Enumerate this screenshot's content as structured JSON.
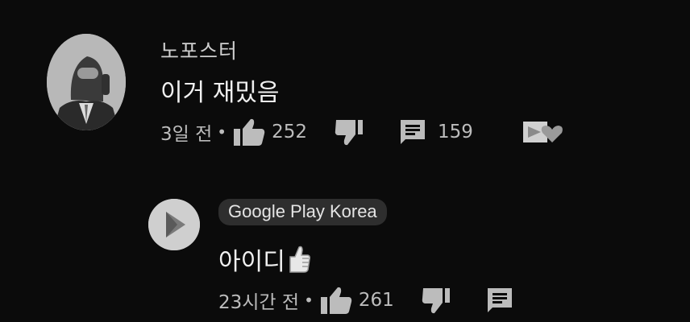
{
  "comment": {
    "author": "노포스터",
    "text": "이거 재밌음",
    "age": "3일 전",
    "dot": "•",
    "like_count": "252",
    "reply_count": "159"
  },
  "reply": {
    "author": "Google Play Korea",
    "text": "아이디",
    "age": "23시간 전",
    "dot": "•",
    "like_count": "261"
  },
  "icons": {
    "like": "thumb-up-icon",
    "dislike": "thumb-down-icon",
    "reply": "comment-icon",
    "creator_heart": "creator-heart-icon",
    "emoji": "thumbs-up-emoji"
  },
  "colors": {
    "background": "#0b0b0b",
    "text": "#f0f0f0",
    "meta": "#bcbcbc",
    "chip": "#2e2e2e"
  }
}
